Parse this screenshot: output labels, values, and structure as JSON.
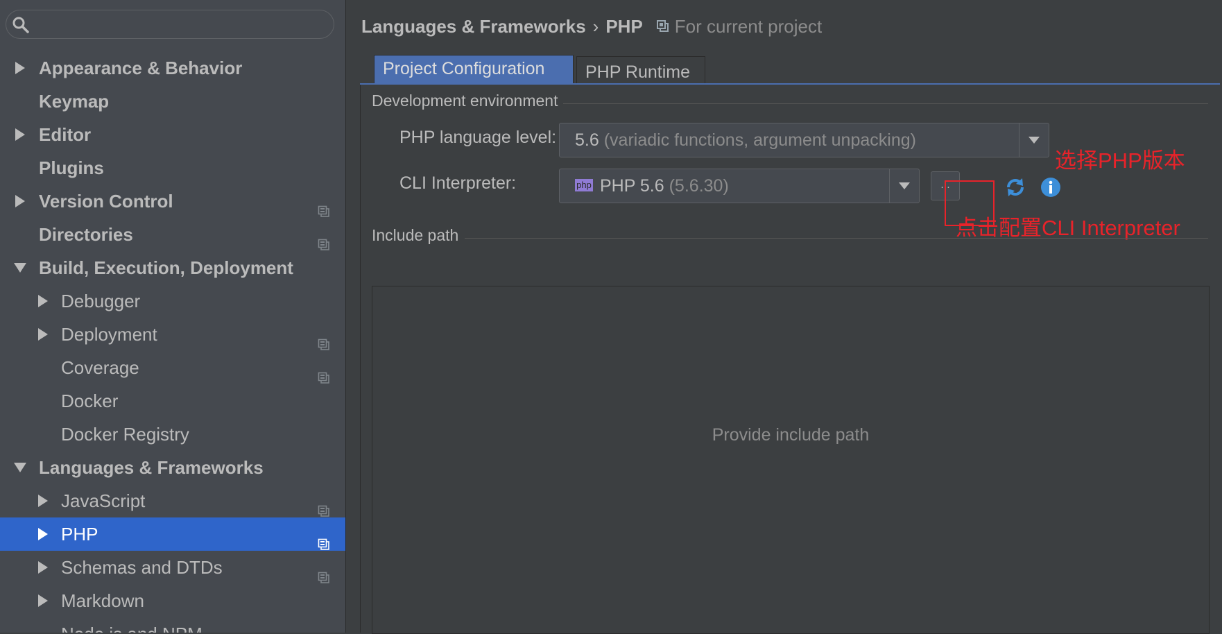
{
  "search": {
    "placeholder": "",
    "icon": "search-icon"
  },
  "sidebar": {
    "items": [
      {
        "label": "Appearance & Behavior",
        "level": 0,
        "arrow": "collapsed",
        "project_scope": false,
        "selected": false
      },
      {
        "label": "Keymap",
        "level": 0,
        "arrow": "none",
        "project_scope": false,
        "selected": false
      },
      {
        "label": "Editor",
        "level": 0,
        "arrow": "collapsed",
        "project_scope": false,
        "selected": false
      },
      {
        "label": "Plugins",
        "level": 0,
        "arrow": "none",
        "project_scope": false,
        "selected": false
      },
      {
        "label": "Version Control",
        "level": 0,
        "arrow": "collapsed",
        "project_scope": true,
        "selected": false
      },
      {
        "label": "Directories",
        "level": 0,
        "arrow": "none",
        "project_scope": true,
        "selected": false
      },
      {
        "label": "Build, Execution, Deployment",
        "level": 0,
        "arrow": "expanded",
        "project_scope": false,
        "selected": false
      },
      {
        "label": "Debugger",
        "level": 1,
        "arrow": "collapsed",
        "project_scope": false,
        "selected": false
      },
      {
        "label": "Deployment",
        "level": 1,
        "arrow": "collapsed",
        "project_scope": true,
        "selected": false
      },
      {
        "label": "Coverage",
        "level": 1,
        "arrow": "none",
        "project_scope": true,
        "selected": false
      },
      {
        "label": "Docker",
        "level": 1,
        "arrow": "none",
        "project_scope": false,
        "selected": false
      },
      {
        "label": "Docker Registry",
        "level": 1,
        "arrow": "none",
        "project_scope": false,
        "selected": false
      },
      {
        "label": "Languages & Frameworks",
        "level": 0,
        "arrow": "expanded",
        "project_scope": false,
        "selected": false
      },
      {
        "label": "JavaScript",
        "level": 1,
        "arrow": "collapsed",
        "project_scope": true,
        "selected": false
      },
      {
        "label": "PHP",
        "level": 1,
        "arrow": "collapsed",
        "project_scope": true,
        "selected": true
      },
      {
        "label": "Schemas and DTDs",
        "level": 1,
        "arrow": "collapsed",
        "project_scope": true,
        "selected": false
      },
      {
        "label": "Markdown",
        "level": 1,
        "arrow": "collapsed",
        "project_scope": false,
        "selected": false
      },
      {
        "label": "Node.js and NPM",
        "level": 1,
        "arrow": "none",
        "project_scope": true,
        "selected": false
      }
    ]
  },
  "header": {
    "breadcrumb": [
      "Languages & Frameworks",
      "PHP"
    ],
    "separator": "›",
    "scope_label": "For current project"
  },
  "tabs": [
    {
      "label": "Project Configuration",
      "active": true
    },
    {
      "label": "PHP Runtime",
      "active": false
    }
  ],
  "dev_env": {
    "title": "Development environment",
    "language_level_label": "PHP language level:",
    "language_level_value": "5.6",
    "language_level_detail": "(variadic functions, argument unpacking)",
    "cli_label": "CLI Interpreter:",
    "cli_badge": "php",
    "cli_value": "PHP 5.6",
    "cli_detail": "(5.6.30)",
    "ellipsis": "...",
    "refresh_icon": "refresh-icon",
    "info_icon": "info-icon"
  },
  "annotations": {
    "language_level": "选择PHP版本",
    "cli": "点击配置CLI Interpreter",
    "color": "#e8232a"
  },
  "include_path": {
    "title": "Include path",
    "empty_text": "Provide include path"
  },
  "colors": {
    "background": "#3c3f41",
    "sidebar": "#45494f",
    "selection": "#2f65ca",
    "active_tab": "#4b6eaf"
  }
}
